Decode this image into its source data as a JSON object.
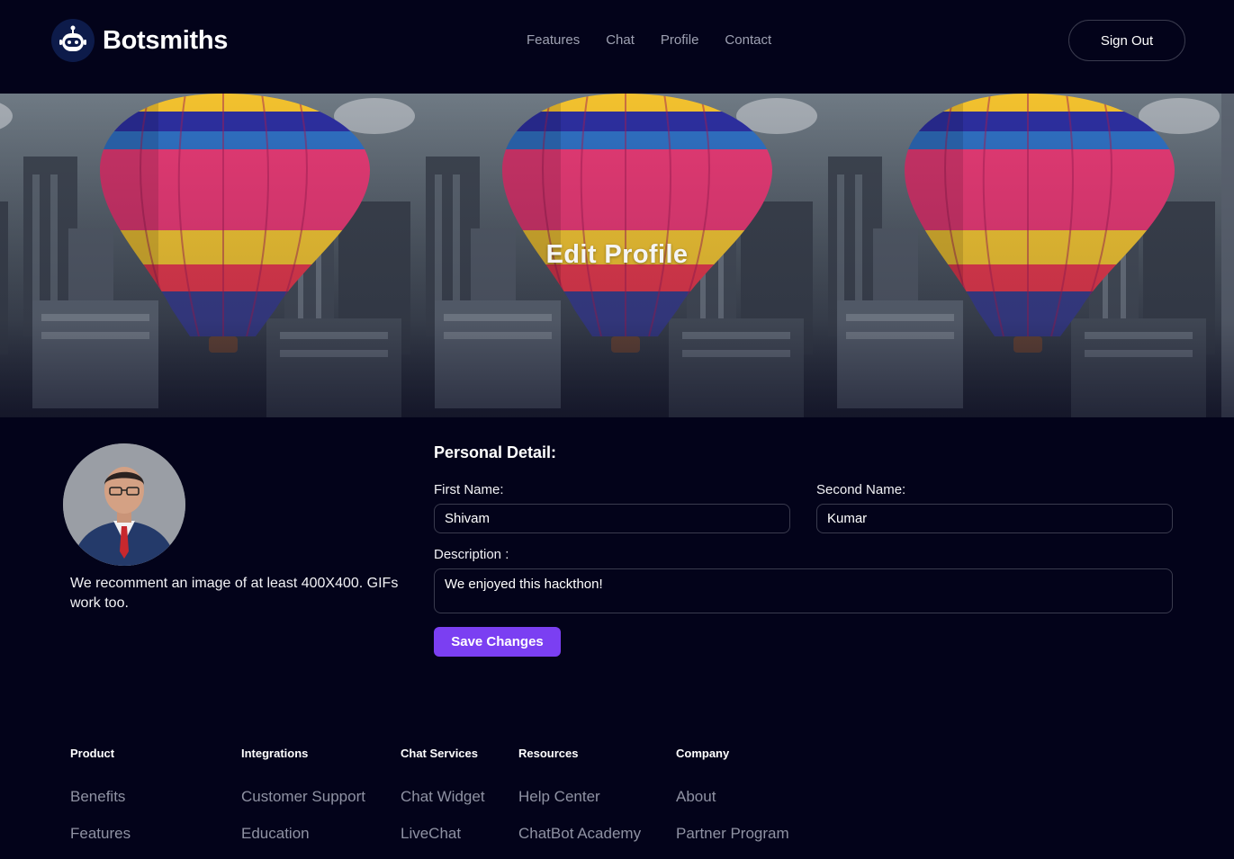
{
  "brand": {
    "name": "Botsmiths",
    "icon": "robot-icon"
  },
  "nav": {
    "items": [
      {
        "label": "Features"
      },
      {
        "label": "Chat"
      },
      {
        "label": "Profile"
      },
      {
        "label": "Contact"
      }
    ],
    "signout_label": "Sign Out"
  },
  "hero": {
    "title": "Edit Profile",
    "image": "hot-air-balloon-over-city"
  },
  "profile": {
    "avatar": "user-avatar-photo",
    "avatar_note": "We recomment an image of at least 400X400. GIFs work too."
  },
  "form": {
    "section_title": "Personal Detail:",
    "first_name_label": "First Name:",
    "first_name_value": "Shivam",
    "second_name_label": "Second Name:",
    "second_name_value": "Kumar",
    "description_label": "Description :",
    "description_value": "We enjoyed this hackthon!",
    "save_label": "Save Changes"
  },
  "footer": {
    "columns": [
      {
        "heading": "Product",
        "links": [
          "Benefits",
          "Features"
        ]
      },
      {
        "heading": "Integrations",
        "links": [
          "Customer Support",
          "Education"
        ]
      },
      {
        "heading": "Chat Services",
        "links": [
          "Chat Widget",
          "LiveChat"
        ]
      },
      {
        "heading": "Resources",
        "links": [
          "Help Center",
          "ChatBot Academy"
        ]
      },
      {
        "heading": "Company",
        "links": [
          "About",
          "Partner Program"
        ]
      }
    ]
  },
  "colors": {
    "background": "#03031a",
    "accent": "#7b3ff2",
    "muted_text": "#9ea1b2",
    "border": "#3a3b4e"
  }
}
